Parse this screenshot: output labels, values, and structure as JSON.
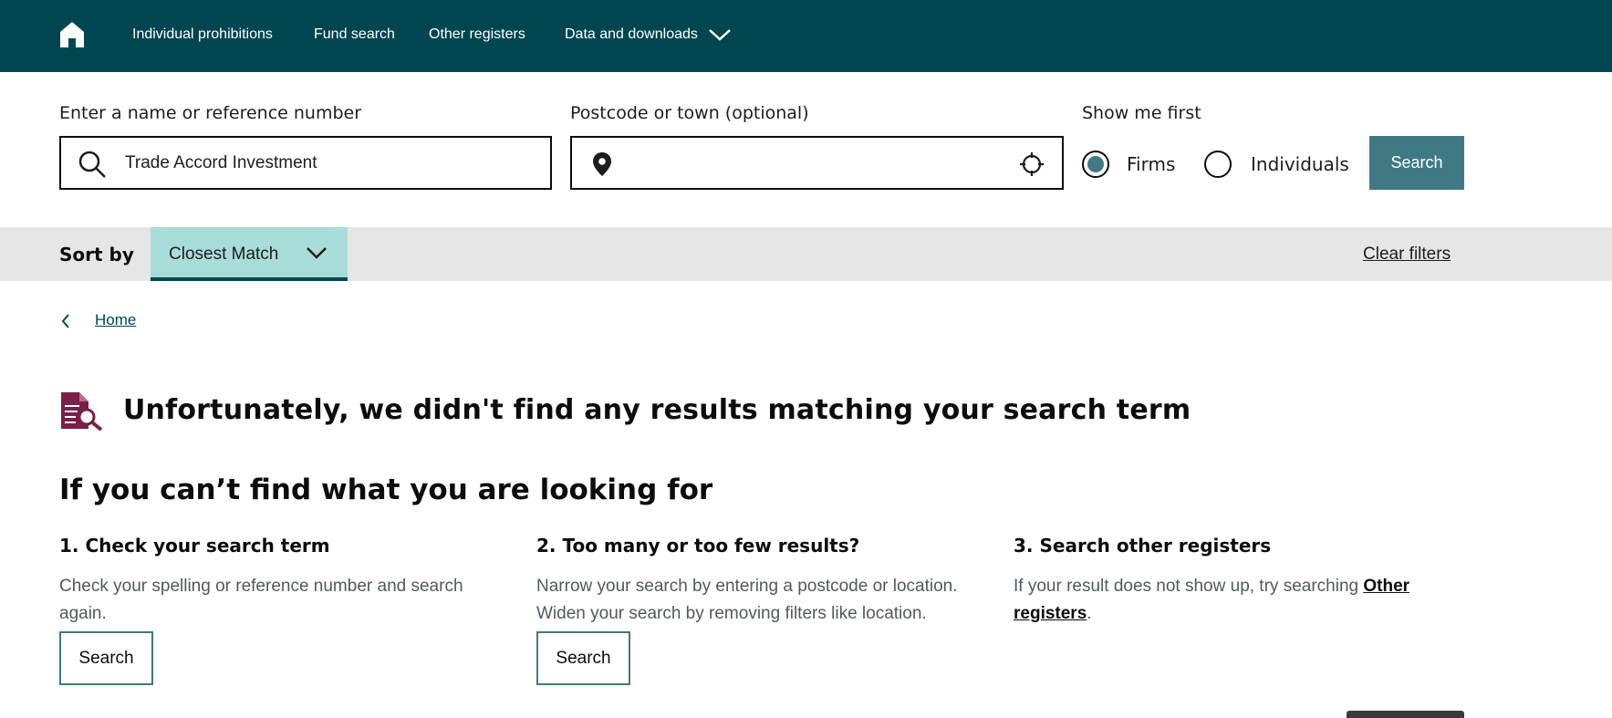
{
  "nav": {
    "items": [
      {
        "label": "Individual prohibitions"
      },
      {
        "label": "Fund search"
      },
      {
        "label": "Other registers"
      },
      {
        "label": "Data and downloads"
      }
    ]
  },
  "search": {
    "name_label": "Enter a name or reference number",
    "name_value": "Trade Accord Investment",
    "postcode_label": "Postcode or town (optional)",
    "postcode_value": "",
    "show_first_label": "Show me first",
    "options": [
      {
        "label": "Firms",
        "selected": true
      },
      {
        "label": "Individuals",
        "selected": false
      }
    ],
    "button_label": "Search"
  },
  "sort": {
    "label": "Sort by",
    "value": "Closest Match",
    "clear_label": "Clear filters"
  },
  "breadcrumb": {
    "home_label": "Home"
  },
  "no_results": {
    "title": "Unfortunately, we didn't find any results matching your search term"
  },
  "help": {
    "title": "If you can’t find what you are looking for",
    "columns": [
      {
        "title": "1. Check your search term",
        "text": "Check your spelling or reference number and search again.",
        "button_label": "Search"
      },
      {
        "title": "2. Too many or too few results?",
        "text_line1": "Narrow your search by entering a postcode or location.",
        "text_line2": "Widen your search by removing filters like location.",
        "button_label": "Search"
      },
      {
        "title": "3. Search other registers",
        "text_before": "If your result does not show up, try searching ",
        "link_label": "Other registers",
        "text_after": "."
      }
    ]
  },
  "colors": {
    "nav_bg": "#004651",
    "accent": "#3f7983",
    "sort_select_bg": "#a8dcd9",
    "sort_bar_bg": "#e6e6e6",
    "icon_color": "#7a1f47"
  },
  "icons": [
    "home-icon",
    "chevron-down-icon",
    "search-icon",
    "location-pin-icon",
    "crosshair-icon",
    "chevron-left-icon",
    "document-search-icon"
  ]
}
